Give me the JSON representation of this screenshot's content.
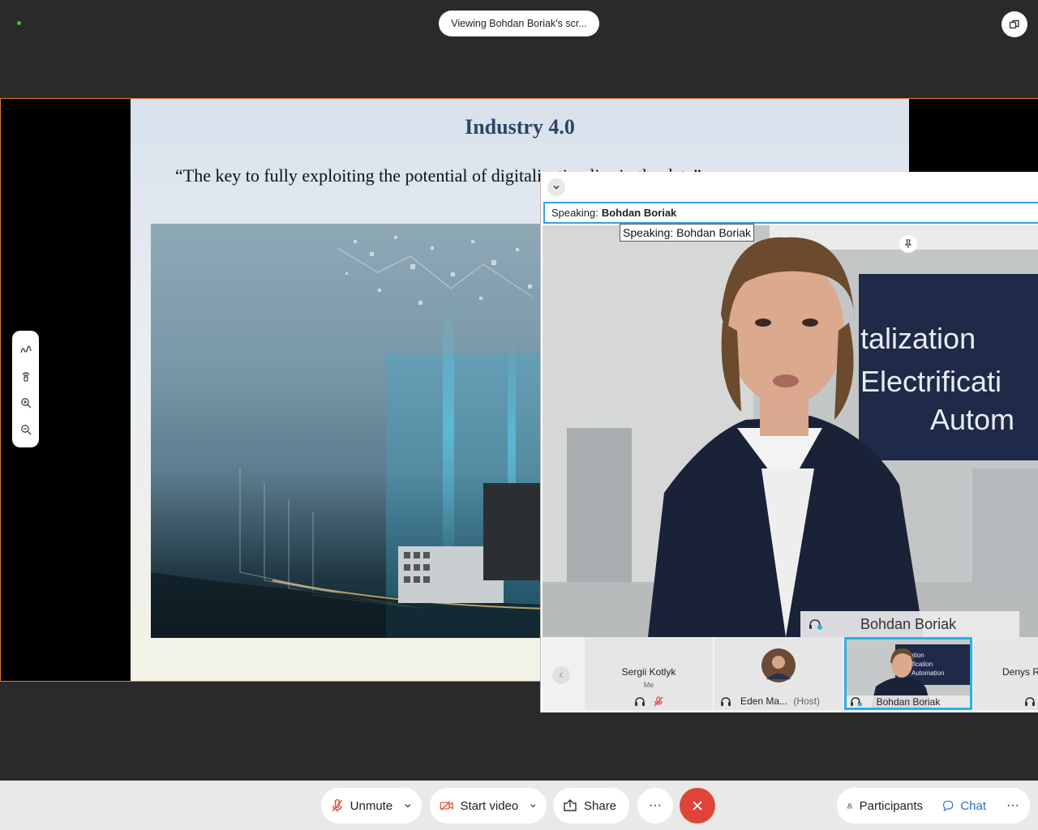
{
  "top": {
    "viewing_label": "Viewing Bohdan Boriak's scr..."
  },
  "slide": {
    "title": "Industry 4.0",
    "quote": "“The key to fully exploiting the potential of digitalization lies in the data”"
  },
  "annotation_tools": [
    "annotate-pen-icon",
    "spotlight-icon",
    "zoom-in-icon",
    "zoom-out-icon"
  ],
  "video_panel": {
    "speaking_prefix": "Speaking:",
    "speaking_name": "Bohdan Boriak",
    "tooltip": "Speaking: Bohdan Boriak",
    "main_name": "Bohdan Boriak",
    "backdrop_lines": [
      "talization",
      "Electrificati",
      "Autom"
    ],
    "thumbnails": [
      {
        "name": "Sergii Kotlyk",
        "sub": "Me"
      },
      {
        "name": "Eden Ma...",
        "sub": "(Host)"
      },
      {
        "name": "Bohdan Boriak",
        "sub": ""
      },
      {
        "name": "Denys R",
        "sub": ""
      }
    ],
    "mini_backdrop": [
      "talization",
      "lectrification",
      "Automation"
    ]
  },
  "toolbar": {
    "unmute": "Unmute",
    "start_video": "Start video",
    "share": "Share",
    "more": "···",
    "participants": "Participants",
    "chat": "Chat",
    "overflow": "···"
  },
  "colors": {
    "accent": "#29b1e6",
    "end_call": "#e0433a",
    "share_border": "#e0793a",
    "mic_muted": "#e04a3a",
    "chat_blue": "#1f73c8"
  }
}
